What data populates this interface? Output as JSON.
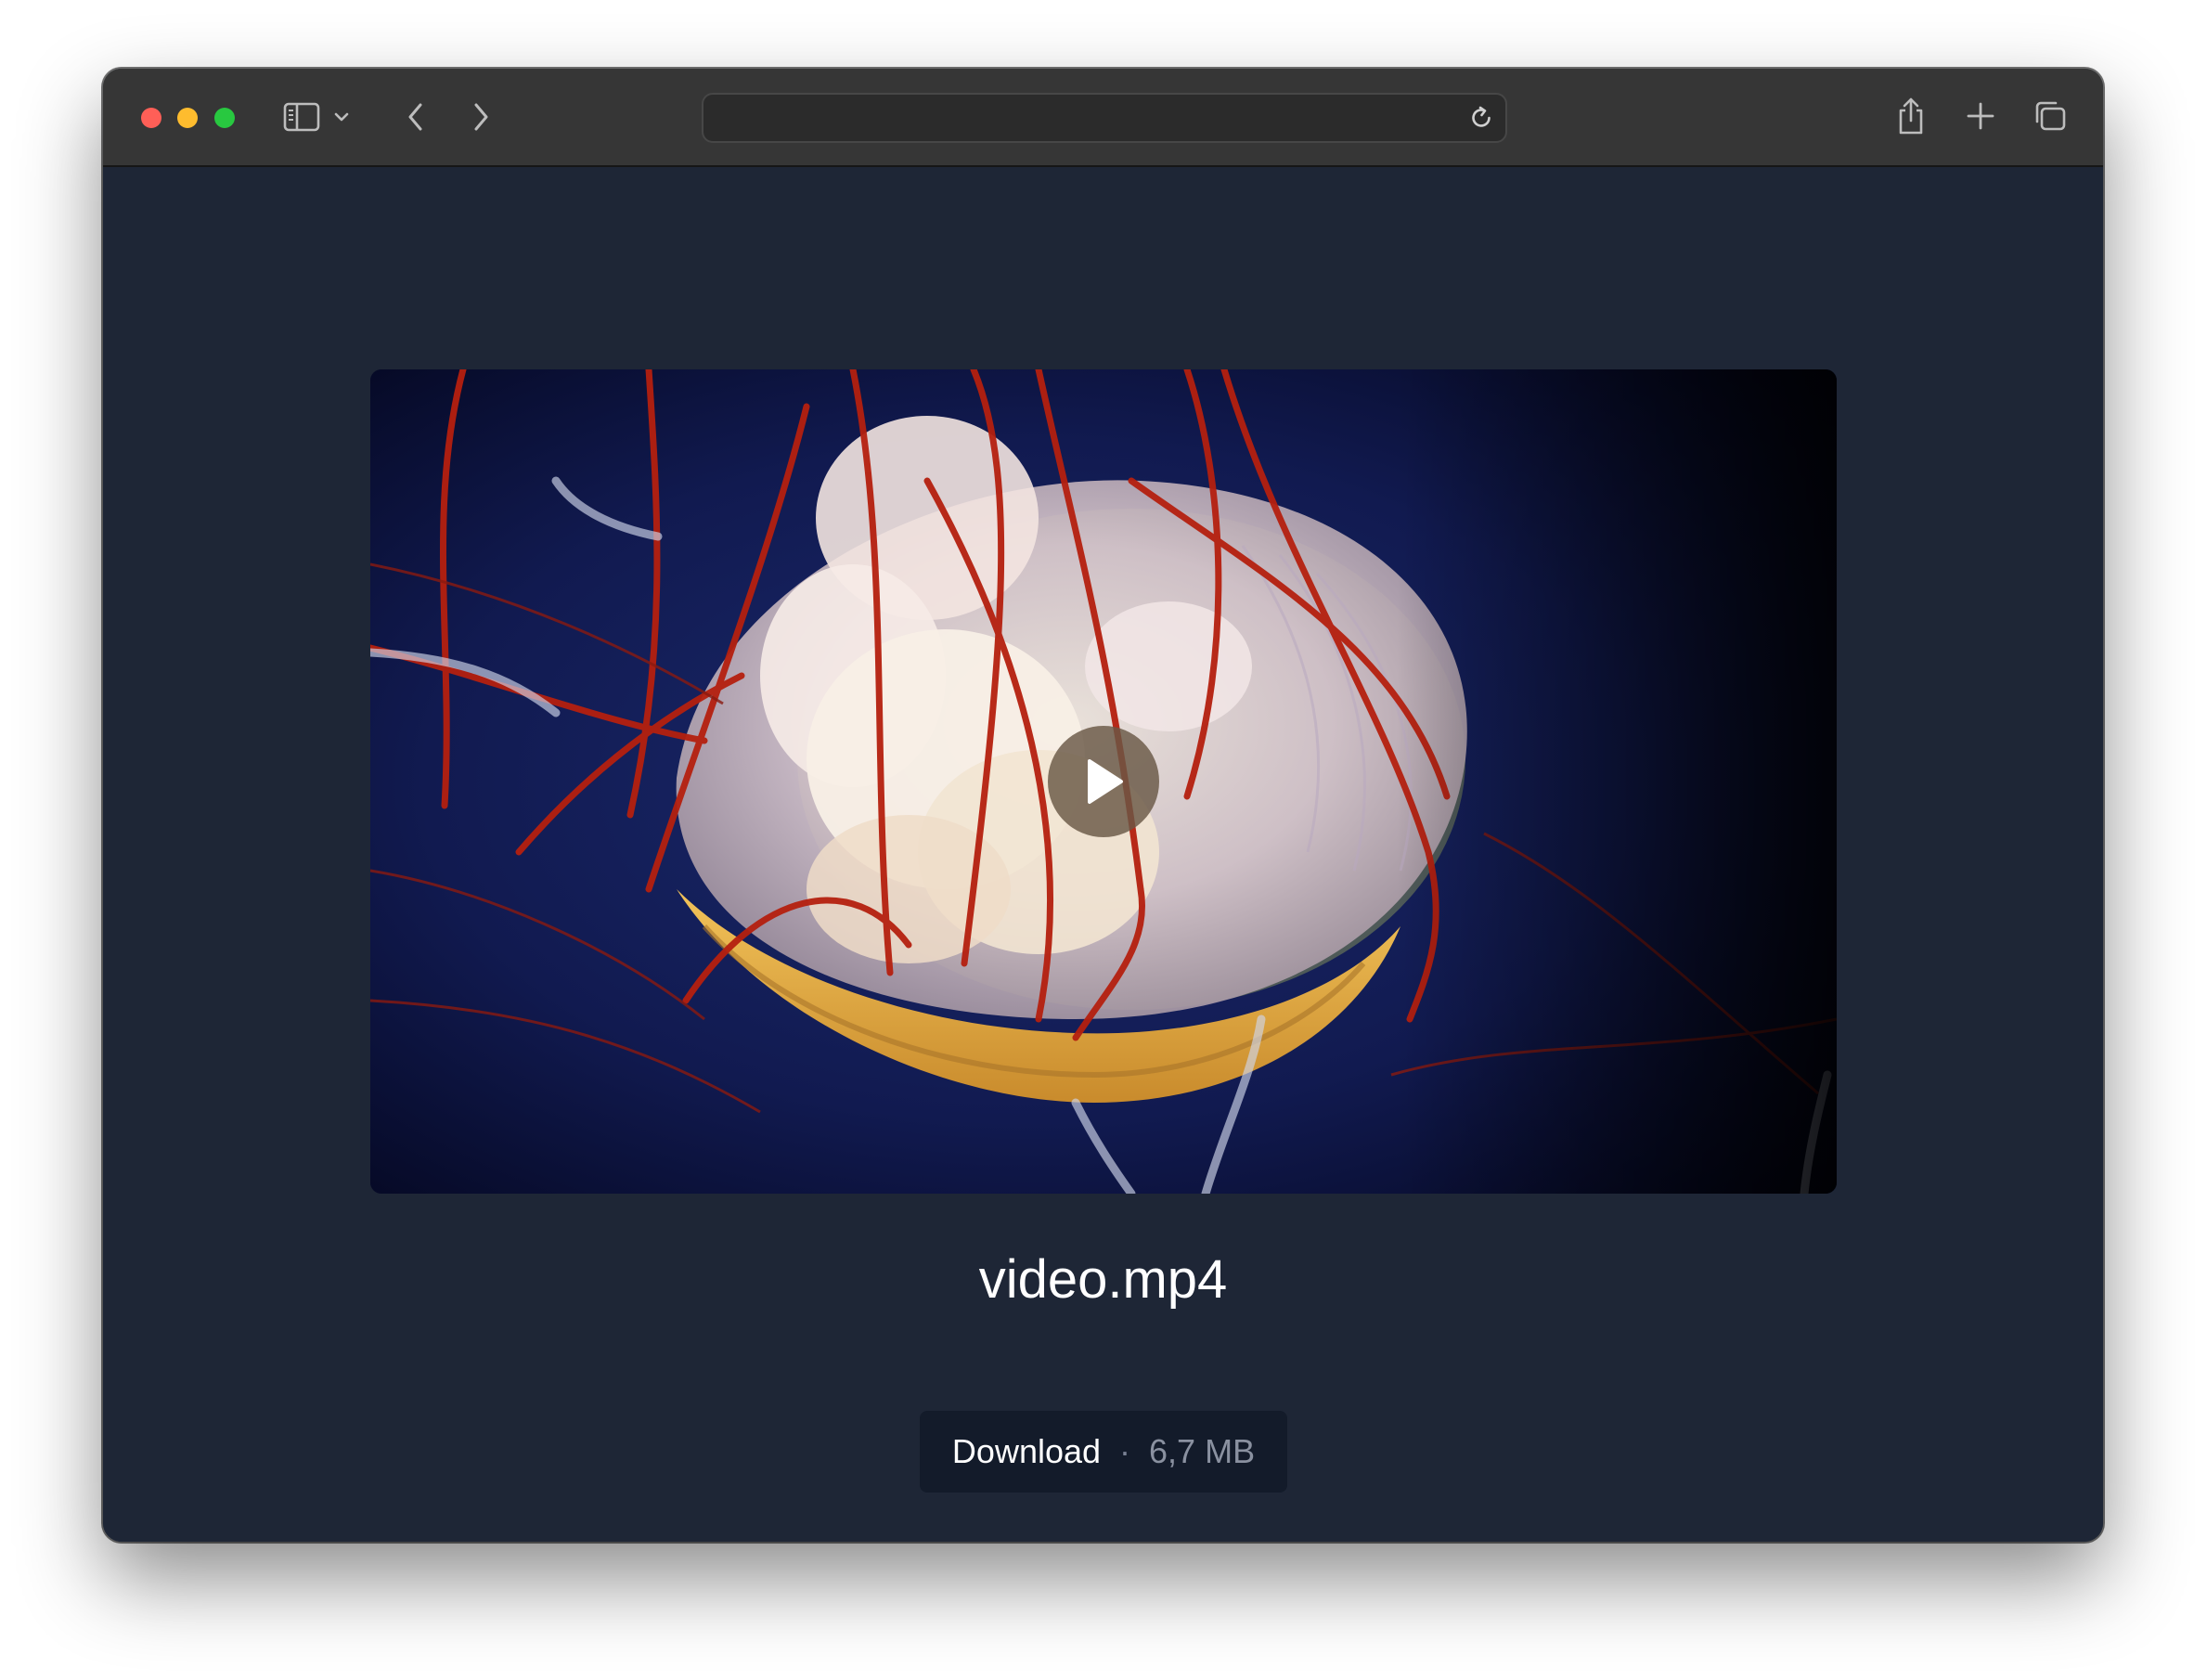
{
  "browser": {
    "address": {
      "value": "",
      "placeholder": ""
    },
    "icons": {
      "close": "close-dot",
      "minimize": "minimize-dot",
      "maximize": "maximize-dot",
      "sidebar": "sidebar-icon",
      "sidebar_menu": "chevron-down-icon",
      "back": "chevron-left-icon",
      "forward": "chevron-right-icon",
      "reload": "reload-icon",
      "share": "share-icon",
      "new_tab": "plus-icon",
      "tabs": "tab-overview-icon"
    },
    "colors": {
      "close": "#ff5f57",
      "minimize": "#febc2e",
      "maximize": "#28c840",
      "toolbar": "#363636"
    }
  },
  "page": {
    "background": "#1e2636",
    "video": {
      "poster": "jellyfish underwater",
      "play_icon": "play-icon"
    },
    "file": {
      "name": "video.mp4",
      "download_label": "Download",
      "separator": "·",
      "size": "6,7 MB"
    }
  }
}
